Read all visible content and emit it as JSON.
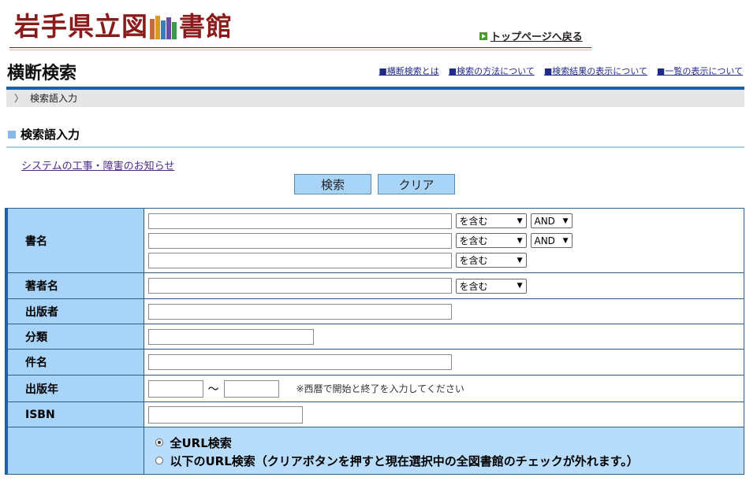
{
  "header": {
    "logo_parts": [
      "岩手",
      "県立図",
      "書館"
    ],
    "logo_colors": {
      "text": "#8b1a1a",
      "books": [
        "#c86a3a",
        "#d49a2a",
        "#3a7ab8",
        "#6a4aa8",
        "#3a9a4a"
      ]
    },
    "top_link": "トップページへ戻る"
  },
  "title_row": {
    "title": "横断検索",
    "links": [
      "横断検索とは",
      "検索の方法について",
      "検索結果の表示について",
      "一覧の表示について"
    ],
    "link_prefix": "■"
  },
  "breadcrumb": {
    "chevron": "〉",
    "current": "検索語入力"
  },
  "section": {
    "title": "検索語入力"
  },
  "notice_link": "システムの工事・障害のお知らせ",
  "buttons": {
    "search": "検索",
    "clear": "クリア"
  },
  "form": {
    "title_label": "書名",
    "title_rows": [
      {
        "value": "",
        "match": "を含む",
        "op": "AND"
      },
      {
        "value": "",
        "match": "を含む",
        "op": "AND"
      },
      {
        "value": "",
        "match": "を含む"
      }
    ],
    "author_label": "著者名",
    "author": {
      "value": "",
      "match": "を含む"
    },
    "publisher_label": "出版者",
    "publisher_value": "",
    "classification_label": "分類",
    "classification_value": "",
    "subject_label": "件名",
    "subject_value": "",
    "year_label": "出版年",
    "year_from": "",
    "year_to": "",
    "year_tilde": "〜",
    "year_hint": "※西暦で開始と終了を入力してください",
    "isbn_label": "ISBN",
    "isbn_value": "",
    "url_options": [
      {
        "label": "全URL検索",
        "selected": true
      },
      {
        "label": "以下のURL検索（クリアボタンを押すと現在選択中の全図書館のチェックが外れます。）",
        "selected": false
      }
    ]
  },
  "colors": {
    "accent_blue": "#1f5fa8",
    "label_bg": "#a8d4fa",
    "button_bg": "#a8d4fa"
  }
}
